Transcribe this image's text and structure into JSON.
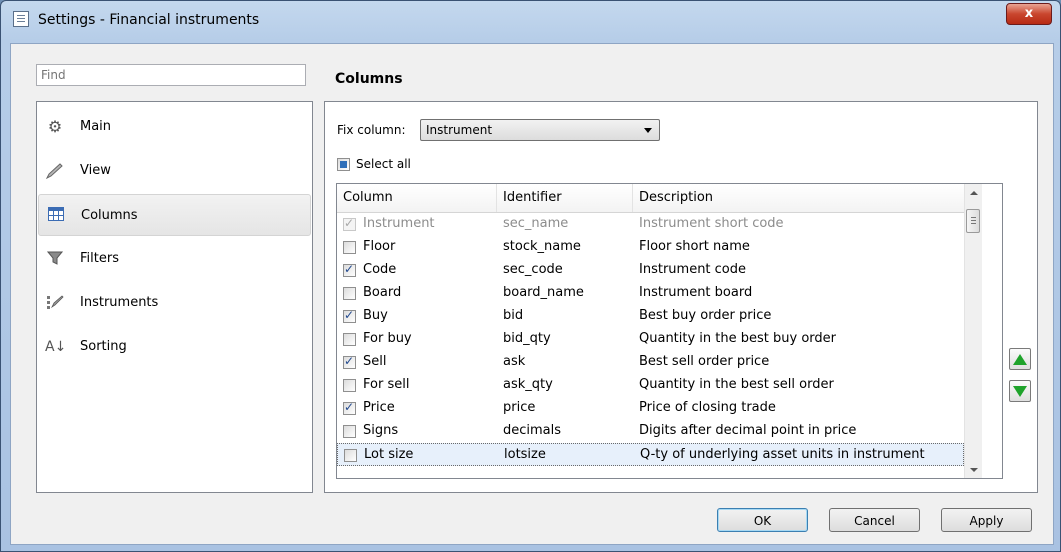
{
  "window": {
    "title": "Settings - Financial instruments",
    "close_glyph": "x"
  },
  "search": {
    "placeholder": "Find"
  },
  "sidebar": {
    "items": [
      {
        "label": "Main",
        "icon": "gear-icon"
      },
      {
        "label": "View",
        "icon": "brush-icon"
      },
      {
        "label": "Columns",
        "icon": "columns-icon",
        "selected": true
      },
      {
        "label": "Filters",
        "icon": "filter-icon"
      },
      {
        "label": "Instruments",
        "icon": "instruments-icon"
      },
      {
        "label": "Sorting",
        "icon": "sort-az-icon"
      }
    ]
  },
  "section": {
    "title": "Columns"
  },
  "fix_column": {
    "label": "Fix column:",
    "value": "Instrument"
  },
  "select_all": {
    "label": "Select all",
    "state": "indeterminate"
  },
  "table": {
    "headers": [
      "Column",
      "Identifier",
      "Description"
    ],
    "rows": [
      {
        "column": "Instrument",
        "identifier": "sec_name",
        "description": "Instrument short code",
        "checked": true,
        "disabled": true
      },
      {
        "column": "Floor",
        "identifier": "stock_name",
        "description": "Floor short name",
        "checked": false
      },
      {
        "column": "Code",
        "identifier": "sec_code",
        "description": "Instrument code",
        "checked": true
      },
      {
        "column": "Board",
        "identifier": "board_name",
        "description": "Instrument board",
        "checked": false
      },
      {
        "column": "Buy",
        "identifier": "bid",
        "description": "Best buy order price",
        "checked": true
      },
      {
        "column": "For buy",
        "identifier": "bid_qty",
        "description": "Quantity in the best buy order",
        "checked": false
      },
      {
        "column": "Sell",
        "identifier": "ask",
        "description": "Best sell order price",
        "checked": true
      },
      {
        "column": "For sell",
        "identifier": "ask_qty",
        "description": "Quantity in the best sell order",
        "checked": false
      },
      {
        "column": "Price",
        "identifier": "price",
        "description": "Price of closing trade",
        "checked": true
      },
      {
        "column": "Signs",
        "identifier": "decimals",
        "description": "Digits after decimal point in price",
        "checked": false
      },
      {
        "column": "Lot size",
        "identifier": "lotsize",
        "description": "Q-ty of underlying asset units in instrument",
        "checked": false,
        "selected": true
      }
    ]
  },
  "buttons": {
    "ok": "OK",
    "cancel": "Cancel",
    "apply": "Apply"
  },
  "colors": {
    "accent_green": "#1fa32b",
    "selection": "#e7f0fb",
    "title_bar": "#b6cde8",
    "close_red": "#c9462e"
  }
}
